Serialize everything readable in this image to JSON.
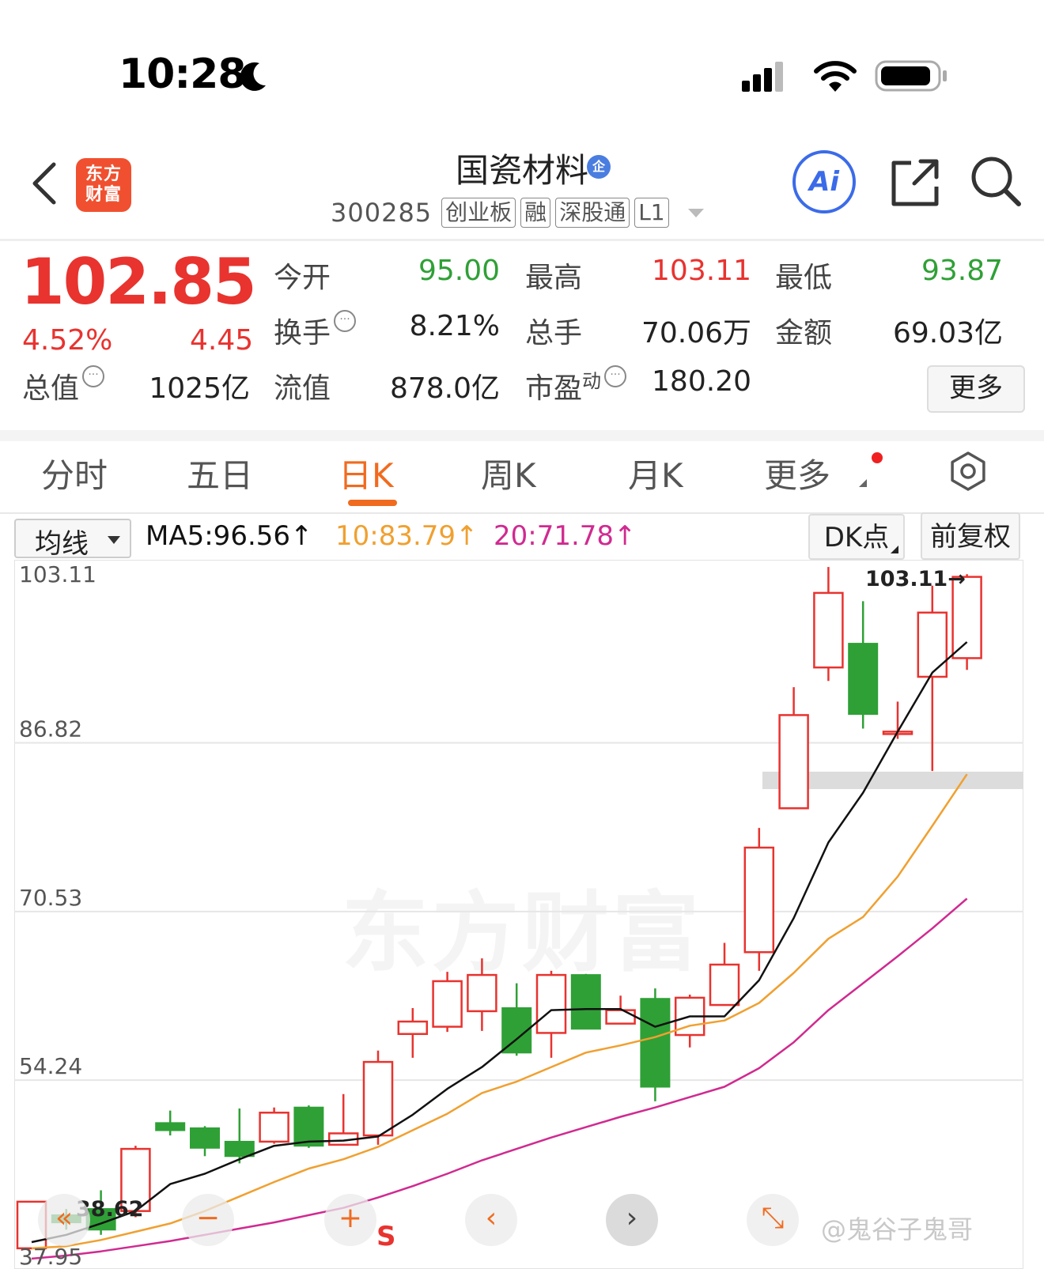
{
  "status_bar": {
    "time": "10:28",
    "moon_icon": "moon-icon",
    "signal_icon": "signal-icon",
    "wifi_icon": "wifi-icon",
    "battery_icon": "battery-icon"
  },
  "header": {
    "back_icon": "chevron-left-icon",
    "logo_line1": "东方",
    "logo_line2": "财富",
    "stock_name": "国瓷材料",
    "enterprise_badge": "企",
    "code": "300285",
    "tags": [
      "创业板",
      "融",
      "深股通",
      "L1"
    ],
    "ai_label": "Ai",
    "share_icon": "share-icon",
    "search_icon": "search-icon"
  },
  "quote": {
    "price": "102.85",
    "change_pct": "4.52%",
    "change": "4.45",
    "open_label": "今开",
    "open": "95.00",
    "high_label": "最高",
    "high": "103.11",
    "low_label": "最低",
    "low": "93.87",
    "turnover_label": "换手",
    "turnover": "8.21%",
    "volume_label": "总手",
    "volume": "70.06万",
    "amount_label": "金额",
    "amount": "69.03亿",
    "mktcap_label": "总值",
    "mktcap": "1025亿",
    "float_label": "流值",
    "float": "878.0亿",
    "pe_label": "市盈",
    "pe_sup": "动",
    "pe": "180.20",
    "more_label": "更多",
    "dots_glyph": "···"
  },
  "tabs": [
    "分时",
    "五日",
    "日K",
    "周K",
    "月K",
    "更多"
  ],
  "active_tab": "日K",
  "indicators": {
    "select_label": "均线",
    "ma5": "MA5:96.56↑",
    "ma10": "10:83.79↑",
    "ma20": "20:71.78↑",
    "dk_label": "DK点",
    "adjust_label": "前复权"
  },
  "colors": {
    "up": "#e8332f",
    "down": "#2fa036",
    "ma5": "#111111",
    "ma10": "#f0a030",
    "ma20": "#d02a90",
    "accent": "#f06b1f"
  },
  "chart_data": {
    "type": "candlestick",
    "y_ticks": [
      "103.11",
      "86.82",
      "70.53",
      "54.24",
      "37.95"
    ],
    "ylim": [
      36.0,
      104.5
    ],
    "max_label": "103.11→",
    "min_label": "38.62",
    "candles": [
      {
        "o": 38.0,
        "c": 42.5,
        "h": 42.5,
        "l": 37.9
      },
      {
        "o": 41.2,
        "c": 40.5,
        "h": 41.8,
        "l": 39.8
      },
      {
        "o": 41.8,
        "c": 39.8,
        "h": 43.6,
        "l": 39.3
      },
      {
        "o": 41.6,
        "c": 47.6,
        "h": 47.9,
        "l": 41.0
      },
      {
        "o": 50.1,
        "c": 49.4,
        "h": 51.3,
        "l": 48.9
      },
      {
        "o": 49.6,
        "c": 47.7,
        "h": 49.8,
        "l": 46.9
      },
      {
        "o": 48.3,
        "c": 46.9,
        "h": 51.5,
        "l": 46.2
      },
      {
        "o": 48.3,
        "c": 51.1,
        "h": 51.6,
        "l": 48.1
      },
      {
        "o": 51.6,
        "c": 47.9,
        "h": 51.8,
        "l": 47.7
      },
      {
        "o": 48.0,
        "c": 49.1,
        "h": 52.9,
        "l": 48.0
      },
      {
        "o": 48.9,
        "c": 56.0,
        "h": 57.1,
        "l": 48.0
      },
      {
        "o": 58.7,
        "c": 59.9,
        "h": 61.2,
        "l": 56.4
      },
      {
        "o": 59.4,
        "c": 63.8,
        "h": 64.7,
        "l": 58.9
      },
      {
        "o": 60.9,
        "c": 64.4,
        "h": 66.0,
        "l": 59.0
      },
      {
        "o": 61.2,
        "c": 56.9,
        "h": 63.6,
        "l": 56.6
      },
      {
        "o": 58.8,
        "c": 64.4,
        "h": 64.8,
        "l": 56.4
      },
      {
        "o": 64.4,
        "c": 59.2,
        "h": 64.5,
        "l": 59.2
      },
      {
        "o": 59.7,
        "c": 61.0,
        "h": 62.4,
        "l": 59.7
      },
      {
        "o": 62.1,
        "c": 53.6,
        "h": 63.1,
        "l": 52.2
      },
      {
        "o": 58.6,
        "c": 62.2,
        "h": 62.5,
        "l": 57.4
      },
      {
        "o": 61.5,
        "c": 65.4,
        "h": 67.5,
        "l": 61.5
      },
      {
        "o": 66.6,
        "c": 76.7,
        "h": 78.6,
        "l": 64.8
      },
      {
        "o": 80.5,
        "c": 89.5,
        "h": 92.2,
        "l": 80.5
      },
      {
        "o": 94.1,
        "c": 101.3,
        "h": 103.8,
        "l": 92.8
      },
      {
        "o": 96.4,
        "c": 89.6,
        "h": 100.5,
        "l": 88.2
      },
      {
        "o": 87.9,
        "c": 87.9,
        "h": 90.8,
        "l": 87.2
      },
      {
        "o": 93.2,
        "c": 99.4,
        "h": 102.0,
        "l": 84.1
      },
      {
        "o": 95.0,
        "c": 102.85,
        "h": 103.11,
        "l": 93.87
      }
    ],
    "ma5": [
      38.6,
      39.3,
      40.4,
      41.6,
      44.2,
      45.2,
      46.6,
      47.9,
      48.3,
      48.4,
      48.8,
      50.9,
      53.4,
      55.5,
      58.2,
      61.0,
      61.1,
      61.1,
      59.4,
      60.4,
      60.4,
      63.9,
      69.9,
      77.2,
      82.0,
      87.9,
      93.6,
      96.56
    ],
    "ma10": [
      38.0,
      38.2,
      38.8,
      39.6,
      40.4,
      41.6,
      43.0,
      44.4,
      45.7,
      46.6,
      47.8,
      49.4,
      51.0,
      53.0,
      54.1,
      55.5,
      56.9,
      57.6,
      58.4,
      59.5,
      60.0,
      61.7,
      64.6,
      67.9,
      70.0,
      73.9,
      78.8,
      83.79
    ],
    "ma20": [
      37.0,
      37.3,
      37.7,
      38.2,
      38.7,
      39.3,
      39.9,
      40.5,
      41.2,
      41.9,
      42.9,
      44.0,
      45.2,
      46.5,
      47.6,
      48.7,
      49.7,
      50.7,
      51.6,
      52.6,
      53.6,
      55.4,
      57.9,
      61.0,
      63.6,
      66.2,
      68.9,
      71.78
    ]
  },
  "floating_buttons": [
    "«",
    "−",
    "+",
    "‹",
    "›",
    "⤡"
  ],
  "s_marker": "S",
  "watermark": "@鬼谷子鬼哥",
  "bg_watermark": "东方财富"
}
